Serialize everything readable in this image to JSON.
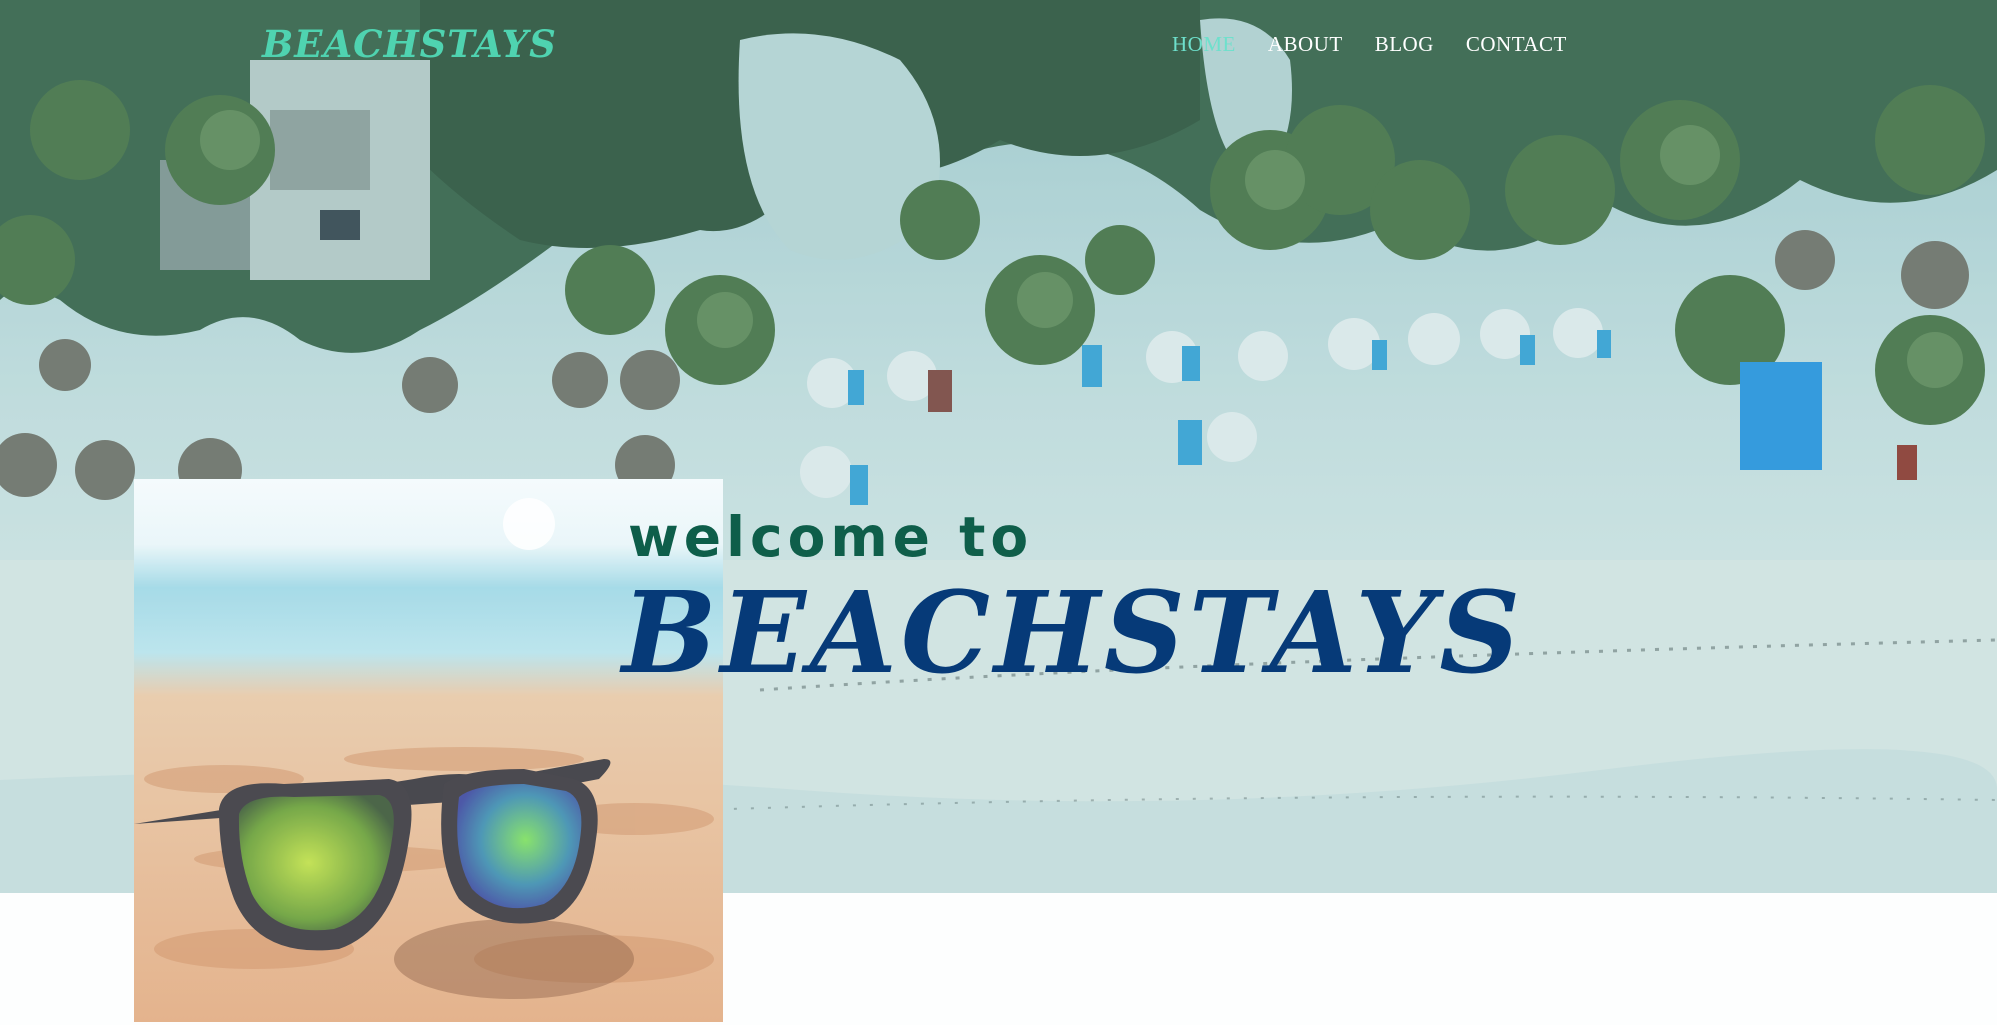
{
  "header": {
    "logo": "BEACHSTAYS",
    "nav": [
      {
        "label": "HOME",
        "active": true
      },
      {
        "label": "ABOUT",
        "active": false
      },
      {
        "label": "BLOG",
        "active": false
      },
      {
        "label": "CONTACT",
        "active": false
      }
    ]
  },
  "hero": {
    "welcome": "welcome to",
    "brand": "BEACHSTAYS",
    "image_alt": "aerial-beach-with-palms-and-umbrellas"
  },
  "photo": {
    "image_alt": "sunglasses-on-sand"
  },
  "colors": {
    "logo": "#4fd3b0",
    "nav_active": "#6ee0cc",
    "nav": "#ffffff",
    "welcome": "#0e5e4a",
    "brand": "#063a78"
  }
}
